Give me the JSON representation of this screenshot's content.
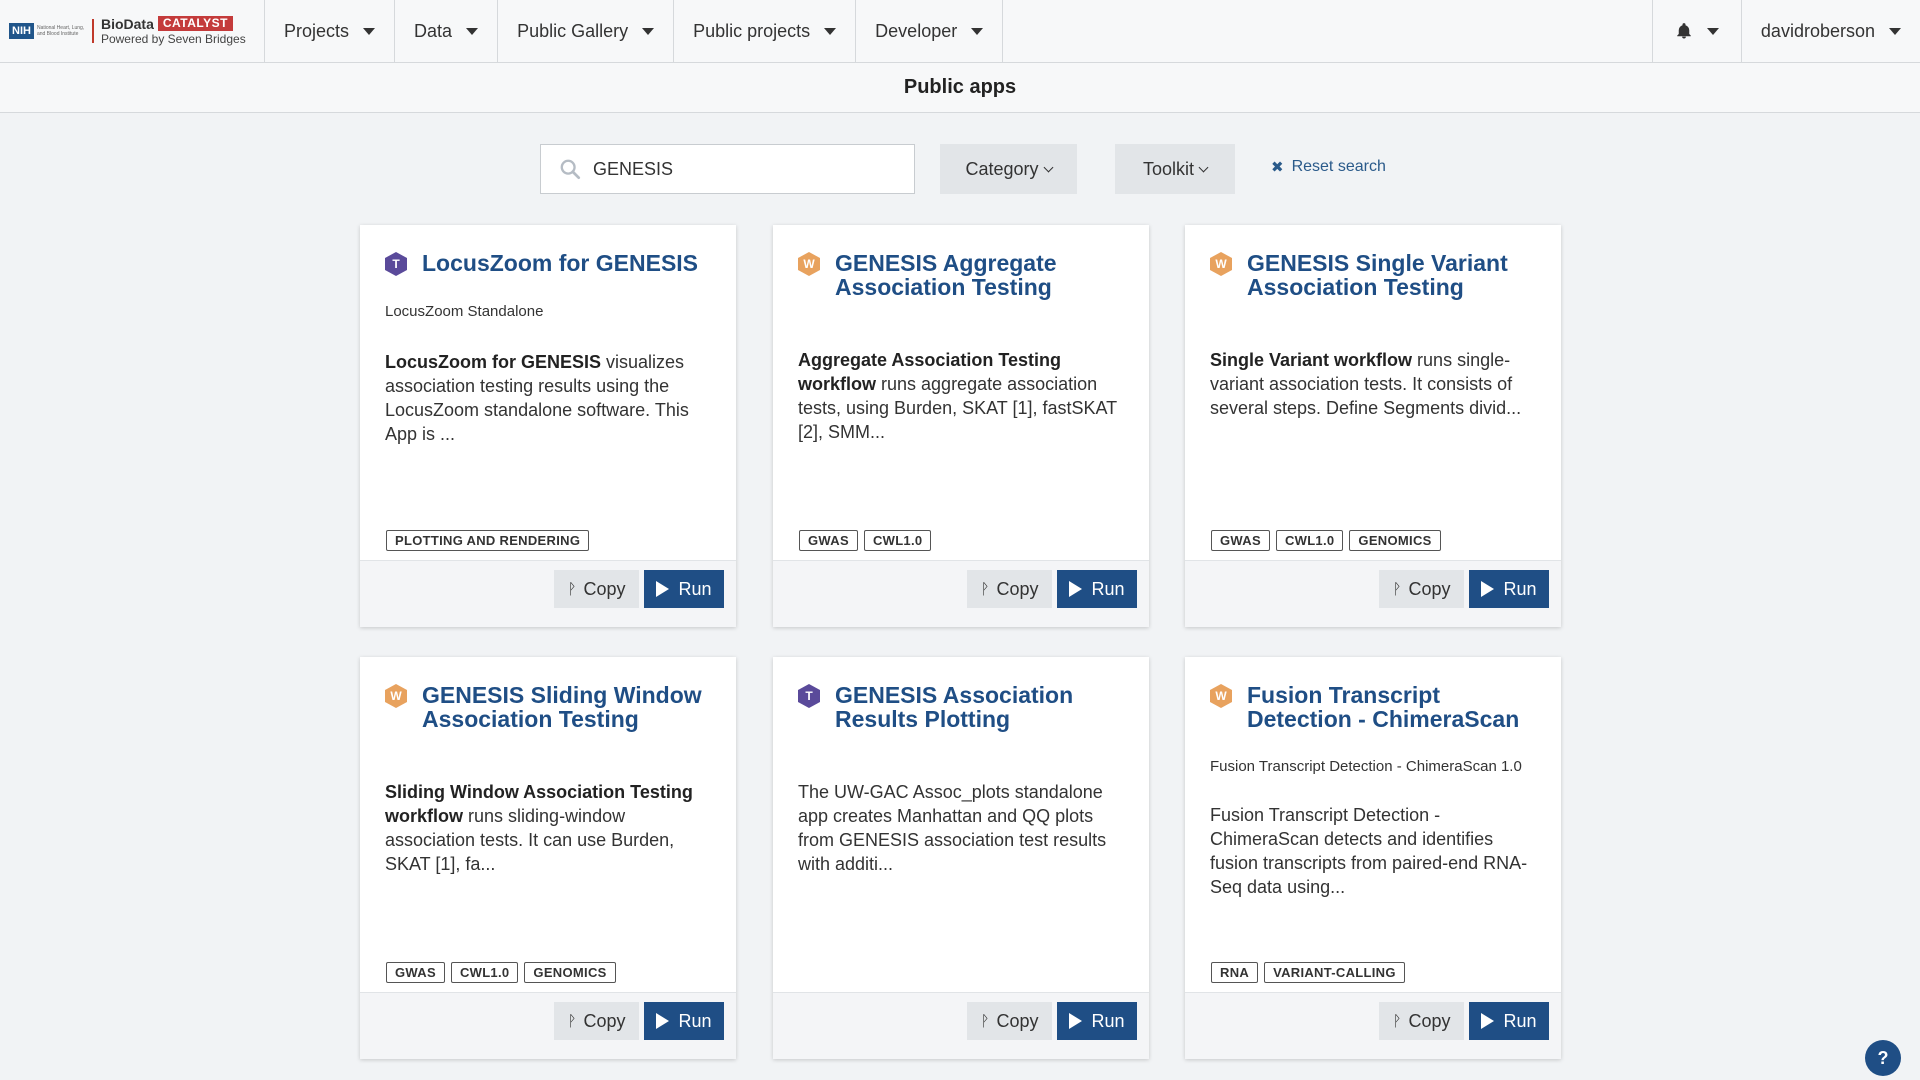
{
  "brand": {
    "nih": "NIH",
    "nih_text": "National Heart, Lung, and Blood Institute",
    "name": "BioData",
    "catalyst": "CATALYST",
    "sub": "Powered by Seven Bridges"
  },
  "nav": {
    "items": [
      {
        "label": "Projects"
      },
      {
        "label": "Data"
      },
      {
        "label": "Public Gallery"
      },
      {
        "label": "Public projects"
      },
      {
        "label": "Developer"
      }
    ],
    "bell": "bell-icon",
    "user": "davidroberson"
  },
  "page": {
    "title": "Public apps"
  },
  "filters": {
    "search_value": "GENESIS",
    "category": "Category",
    "toolkit": "Toolkit",
    "reset": "Reset search"
  },
  "buttons": {
    "copy": "Copy",
    "run": "Run"
  },
  "cards": [
    {
      "badge": "T",
      "title": "LocusZoom for GENESIS",
      "subtitle": "LocusZoom Standalone",
      "desc_bold": "LocusZoom for GENESIS",
      "desc_rest": " visualizes association testing results using the LocusZoom standalone software. This App is ...",
      "tags": [
        "PLOTTING AND RENDERING"
      ]
    },
    {
      "badge": "W",
      "title": "GENESIS Aggregate Association Testing",
      "subtitle": "",
      "desc_bold": "Aggregate Association Testing workflow",
      "desc_rest": " runs aggregate association tests, using Burden, SKAT [1], fastSKAT [2], SMM...",
      "tags": [
        "GWAS",
        "CWL1.0"
      ]
    },
    {
      "badge": "W",
      "title": "GENESIS Single Variant Association Testing",
      "subtitle": "",
      "desc_bold": "Single Variant workflow",
      "desc_rest": " runs single-variant association tests. It consists of several steps. Define Segments divid...",
      "tags": [
        "GWAS",
        "CWL1.0",
        "GENOMICS"
      ]
    },
    {
      "badge": "W",
      "title": "GENESIS Sliding Window Association Testing",
      "subtitle": "",
      "desc_bold": "Sliding Window Association Testing workflow",
      "desc_rest": " runs sliding-window association tests. It can use Burden, SKAT [1], fa...",
      "tags": [
        "GWAS",
        "CWL1.0",
        "GENOMICS"
      ]
    },
    {
      "badge": "T",
      "title": "GENESIS Association Results Plotting",
      "subtitle": "",
      "desc_bold": "",
      "desc_rest": "The UW-GAC Assoc_plots standalone app creates Manhattan and QQ plots from GENESIS association test results with additi...",
      "tags": []
    },
    {
      "badge": "W",
      "title": "Fusion Transcript Detection - ChimeraScan",
      "subtitle": "Fusion Transcript Detection - ChimeraScan 1.0",
      "desc_bold": "",
      "desc_rest": "Fusion Transcript Detection - ChimeraScan detects and identifies fusion transcripts from paired-end RNA-Seq data using...",
      "tags": [
        "RNA",
        "VARIANT-CALLING"
      ]
    }
  ],
  "help": "?"
}
